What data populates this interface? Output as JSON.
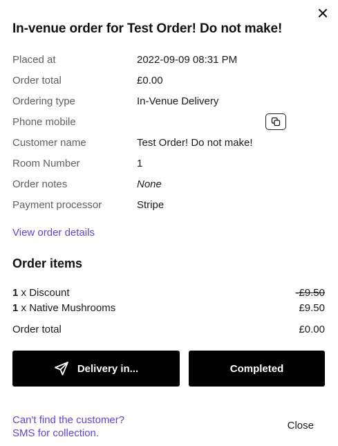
{
  "title": "In-venue order for Test Order! Do not make!",
  "details": [
    {
      "label": "Placed at",
      "value": "2022-09-09 08:31 PM"
    },
    {
      "label": "Order total",
      "value": "£0.00"
    },
    {
      "label": "Ordering type",
      "value": "In-Venue Delivery"
    },
    {
      "label": "Phone mobile",
      "value": ""
    },
    {
      "label": "Customer name",
      "value": "Test Order! Do not make!"
    },
    {
      "label": "Room Number",
      "value": "1"
    },
    {
      "label": "Order notes",
      "value": "None"
    },
    {
      "label": "Payment processor",
      "value": "Stripe"
    }
  ],
  "view_order_details": "View order details",
  "items_heading": "Order items",
  "items": [
    {
      "qty": "1",
      "sep": " x ",
      "name": "Discount",
      "price": "-£9.50",
      "struck": true
    },
    {
      "qty": "1",
      "sep": " x ",
      "name": "Native Mushrooms",
      "price": "£9.50",
      "struck": false
    }
  ],
  "total": {
    "label": "Order total",
    "value": "£0.00"
  },
  "buttons": {
    "delivery": "Delivery in...",
    "completed": "Completed"
  },
  "footer": {
    "link_line1": "Can't find the customer?",
    "link_line2": "SMS for collection.",
    "close": "Close"
  },
  "icons": {
    "close": "close-icon",
    "copy": "copy-icon",
    "send": "send-icon"
  },
  "colors": {
    "accent": "#5b45e0",
    "button": "#000000"
  }
}
